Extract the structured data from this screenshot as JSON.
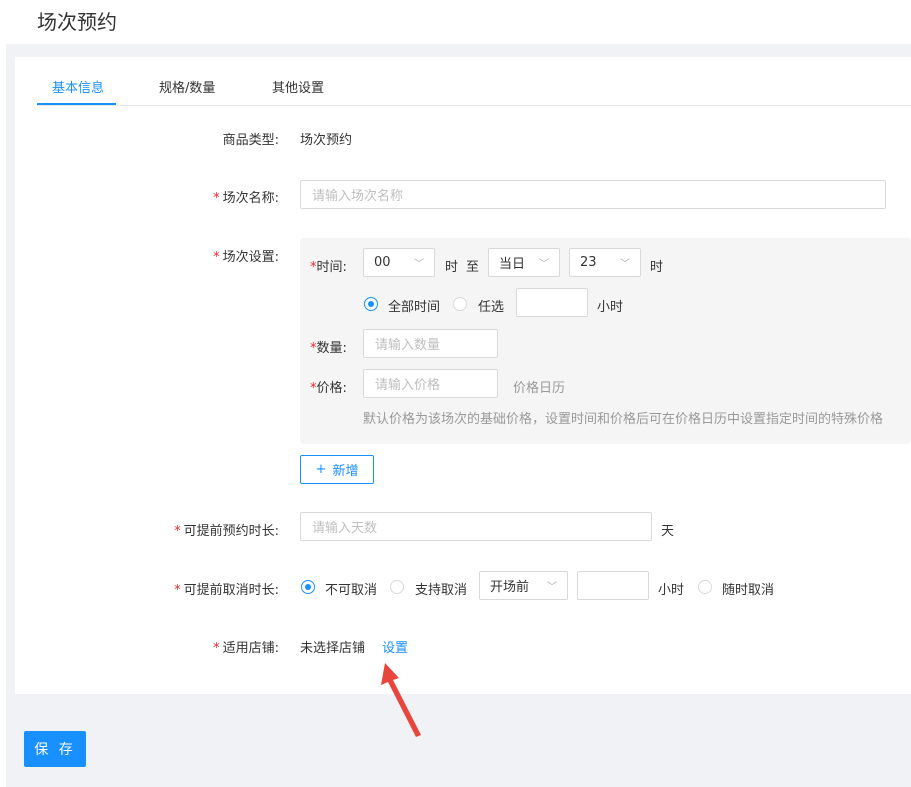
{
  "page": {
    "title": "场次预约"
  },
  "tabs": [
    {
      "label": "基本信息",
      "active": true
    },
    {
      "label": "规格/数量",
      "active": false
    },
    {
      "label": "其他设置",
      "active": false
    }
  ],
  "form": {
    "product_type": {
      "label": "商品类型:",
      "value": "场次预约"
    },
    "session_name": {
      "label": "场次名称:",
      "placeholder": "请输入场次名称"
    },
    "session_settings": {
      "label": "场次设置:",
      "time": {
        "label": "时间:",
        "start_hour": "00",
        "hour_unit": "时",
        "to": "至",
        "day": "当日",
        "end_hour": "23",
        "end_unit": "时"
      },
      "duration": {
        "all_time": "全部时间",
        "optional": "任选",
        "hours_unit": "小时"
      },
      "quantity": {
        "label": "数量:",
        "placeholder": "请输入数量"
      },
      "price": {
        "label": "价格:",
        "placeholder": "请输入价格",
        "calendar": "价格日历"
      },
      "hint": "默认价格为该场次的基础价格，设置时间和价格后可在价格日历中设置指定时间的特殊价格"
    },
    "add_button": "新增",
    "advance_booking": {
      "label": "可提前预约时长:",
      "placeholder": "请输入天数",
      "unit": "天"
    },
    "advance_cancel": {
      "label": "可提前取消时长:",
      "not_cancelable": "不可取消",
      "cancelable": "支持取消",
      "before_start": "开场前",
      "hours_unit": "小时",
      "anytime": "随时取消"
    },
    "stores": {
      "label": "适用店铺:",
      "value": "未选择店铺",
      "action": "设置"
    }
  },
  "save_button": "保 存",
  "colors": {
    "primary": "#1890ff",
    "required": "#f5222d",
    "annotation_arrow": "#e8453c"
  }
}
